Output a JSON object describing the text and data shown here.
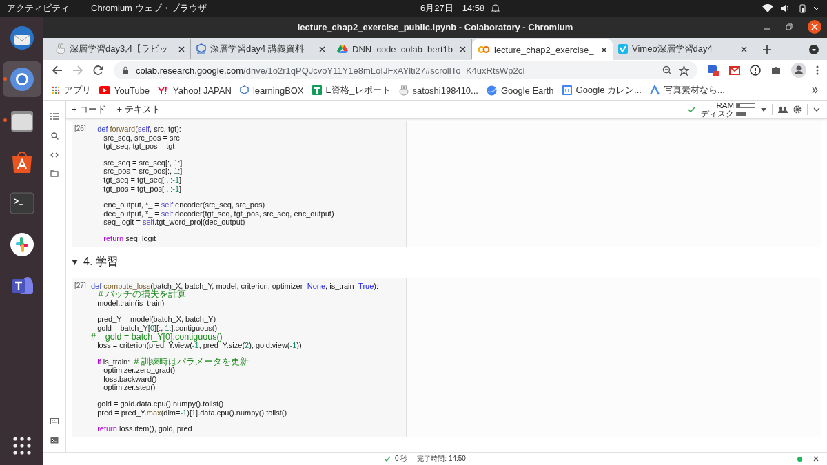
{
  "system_bar": {
    "activities": "アクティビティ",
    "app_menu": "Chromium ウェブ・ブラウザ",
    "clock": "6月27日　14:58"
  },
  "dock": [
    {
      "kind": "mail",
      "running": false
    },
    {
      "kind": "browser",
      "running": true
    },
    {
      "kind": "files",
      "running": true
    },
    {
      "kind": "store",
      "running": false
    },
    {
      "kind": "terminal",
      "running": false
    },
    {
      "kind": "slack",
      "running": false
    },
    {
      "kind": "teams",
      "running": false
    }
  ],
  "window": {
    "title": "lecture_chap2_exercise_public.ipynb - Colaboratory - Chromium"
  },
  "tabs": [
    {
      "kind": "rabbit",
      "title": "深層学習day3,4【ラビッ",
      "selected": false
    },
    {
      "kind": "cube",
      "title": "深層学習day4 講義資料",
      "selected": false
    },
    {
      "kind": "drive",
      "title": "DNN_code_colab_bert1b",
      "selected": false
    },
    {
      "kind": "colab",
      "title": "lecture_chap2_exercise_",
      "selected": true
    },
    {
      "kind": "vimeo",
      "title": "Vimeo深層学習day4",
      "selected": false
    }
  ],
  "address": {
    "host": "colab.research.google.com",
    "path": "/drive/1o2r1qPQJcvoY11Y1e8mLoIJFxAYlti27#scrollTo=K4uxRtsWp2cI"
  },
  "bookmarks": [
    {
      "kind": "grid",
      "label": "アプリ"
    },
    {
      "kind": "youtube",
      "label": "YouTube"
    },
    {
      "kind": "yahoo",
      "label": "Yahoo! JAPAN"
    },
    {
      "kind": "cube",
      "label": "learningBOX"
    },
    {
      "kind": "sheet",
      "label": "E資格_レポート"
    },
    {
      "kind": "rabbit",
      "label": "satoshi198410..."
    },
    {
      "kind": "earth",
      "label": "Google Earth"
    },
    {
      "kind": "calendar",
      "label": "Google カレン..."
    },
    {
      "kind": "arrow",
      "label": "写真素材なら..."
    }
  ],
  "toolbar": {
    "add_code": "+ コード",
    "add_text": "+ テキスト",
    "ram_label": "RAM",
    "disk_label": "ディスク",
    "ram": {
      "level": 0.2
    },
    "disk": {
      "level": 0.5
    }
  },
  "cells": [
    {
      "kind": "code",
      "count": "[26]",
      "blocks": [
        [
          [
            {
              "t": "   def ",
              "kind": "k"
            },
            {
              "t": "forward",
              "kind": "f"
            },
            {
              "t": "(",
              "kind": "p"
            },
            {
              "t": "self",
              "kind": "s"
            },
            {
              "t": ", src, tgt):",
              "kind": "p"
            }
          ],
          [
            {
              "t": "      src_seq, src_pos = src",
              "kind": "p"
            }
          ],
          [
            {
              "t": "      tgt_seq, tgt_pos = tgt",
              "kind": "p"
            }
          ]
        ],
        [
          [
            {
              "t": "      src_seq = src_seq[:, ",
              "kind": "p"
            },
            {
              "t": "1",
              "kind": "n"
            },
            {
              "t": ":]",
              "kind": "p"
            }
          ],
          [
            {
              "t": "      src_pos = src_pos[:, ",
              "kind": "p"
            },
            {
              "t": "1",
              "kind": "n"
            },
            {
              "t": ":]",
              "kind": "p"
            }
          ],
          [
            {
              "t": "      tgt_seq = tgt_seq[:, :",
              "kind": "p"
            },
            {
              "t": "-1",
              "kind": "n"
            },
            {
              "t": "]",
              "kind": "p"
            }
          ],
          [
            {
              "t": "      tgt_pos = tgt_pos[:, :",
              "kind": "p"
            },
            {
              "t": "-1",
              "kind": "n"
            },
            {
              "t": "]",
              "kind": "p"
            }
          ]
        ],
        [
          [
            {
              "t": "      enc_output, *_ = ",
              "kind": "p"
            },
            {
              "t": "self",
              "kind": "s"
            },
            {
              "t": ".encoder(src_seq, src_pos)",
              "kind": "p"
            }
          ],
          [
            {
              "t": "      dec_output, *_ = ",
              "kind": "p"
            },
            {
              "t": "self",
              "kind": "s"
            },
            {
              "t": ".decoder(tgt_seq, tgt_pos, src_seq, enc_output)",
              "kind": "p"
            }
          ],
          [
            {
              "t": "      seq_logit = ",
              "kind": "p"
            },
            {
              "t": "self",
              "kind": "s"
            },
            {
              "t": ".tgt_word_proj(dec_output)",
              "kind": "p"
            }
          ]
        ],
        [
          [
            {
              "t": "      return",
              "kind": "r"
            },
            {
              "t": " seq_logit",
              "kind": "p"
            }
          ]
        ]
      ]
    },
    {
      "kind": "heading",
      "text": "4. 学習",
      "expanded": true
    },
    {
      "kind": "code",
      "count": "[27]",
      "blocks": [
        [
          [
            {
              "t": "def ",
              "kind": "k"
            },
            {
              "t": "compute_loss",
              "kind": "f"
            },
            {
              "t": "(batch_X, batch_Y, model, criterion, optimizer=",
              "kind": "p"
            },
            {
              "t": "None",
              "kind": "b"
            },
            {
              "t": ", is_train=",
              "kind": "p"
            },
            {
              "t": "True",
              "kind": "b"
            },
            {
              "t": "):",
              "kind": "p"
            }
          ],
          [
            {
              "t": "   # バッチの損失を計算",
              "kind": "c"
            }
          ],
          [
            {
              "t": "   model.train(is_train)",
              "kind": "p"
            }
          ]
        ],
        [
          [
            {
              "t": "   pred_Y = model(batch_X, batch_Y)",
              "kind": "p"
            }
          ],
          [
            {
              "t": "   gold = batch_Y[",
              "kind": "p"
            },
            {
              "t": "0",
              "kind": "n"
            },
            {
              "t": "][:, ",
              "kind": "p"
            },
            {
              "t": "1",
              "kind": "n"
            },
            {
              "t": ":].contiguous()",
              "kind": "p"
            }
          ],
          [
            {
              "t": "#    gold = batch_Y[0].contiguous()",
              "kind": "c"
            }
          ],
          [
            {
              "t": "   loss = criterion(pred_Y.view(",
              "kind": "p"
            },
            {
              "t": "-1",
              "kind": "n"
            },
            {
              "t": ", pred_Y.size(",
              "kind": "p"
            },
            {
              "t": "2",
              "kind": "n"
            },
            {
              "t": "), gold.view(",
              "kind": "p"
            },
            {
              "t": "-1",
              "kind": "n"
            },
            {
              "t": "))",
              "kind": "p"
            }
          ]
        ],
        [
          [
            {
              "t": "   if",
              "kind": "r"
            },
            {
              "t": " is_train:  ",
              "kind": "p"
            },
            {
              "t": "# 訓練時はパラメータを更新",
              "kind": "c"
            }
          ],
          [
            {
              "t": "      optimizer.zero_grad()",
              "kind": "p"
            }
          ],
          [
            {
              "t": "      loss.backward()",
              "kind": "p"
            }
          ],
          [
            {
              "t": "      optimizer.step()",
              "kind": "p"
            }
          ]
        ],
        [
          [
            {
              "t": "   gold = gold.data.cpu().numpy().tolist()",
              "kind": "p"
            }
          ],
          [
            {
              "t": "   pred = pred_Y.",
              "kind": "p"
            },
            {
              "t": "max",
              "kind": "f"
            },
            {
              "t": "(dim=",
              "kind": "p"
            },
            {
              "t": "-1",
              "kind": "n"
            },
            {
              "t": ")[",
              "kind": "p"
            },
            {
              "t": "1",
              "kind": "n"
            },
            {
              "t": "].data.cpu().numpy().tolist()",
              "kind": "p"
            }
          ]
        ],
        [
          [
            {
              "t": "   return",
              "kind": "r"
            },
            {
              "t": " loss.item(), gold, pred",
              "kind": "p"
            }
          ]
        ]
      ]
    }
  ],
  "status": {
    "elapsed": "0 秒",
    "finished": "完了時間: 14:50"
  }
}
